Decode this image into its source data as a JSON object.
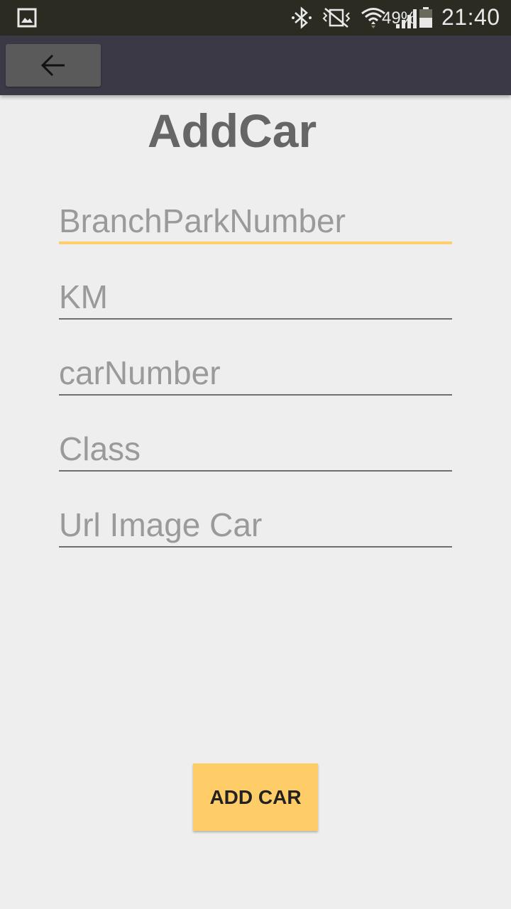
{
  "status_bar": {
    "battery_percent": "49%",
    "time": "21:40",
    "icons": [
      "gallery-icon",
      "bluetooth-icon",
      "vibrate-mute-icon",
      "wifi-icon",
      "signal-icon",
      "battery-icon"
    ]
  },
  "app_bar": {
    "back_icon": "arrow-left-icon"
  },
  "page": {
    "title": "AddCar"
  },
  "form": {
    "fields": [
      {
        "placeholder": "BranchParkNumber",
        "value": ""
      },
      {
        "placeholder": "KM",
        "value": ""
      },
      {
        "placeholder": "carNumber",
        "value": ""
      },
      {
        "placeholder": "Class",
        "value": ""
      },
      {
        "placeholder": "Url Image Car",
        "value": ""
      }
    ],
    "submit_label": "ADD CAR"
  },
  "colors": {
    "status_bar_bg": "#2c2b22",
    "app_bar_bg": "#3c3947",
    "page_bg": "#eeeeee",
    "accent": "#ffcd67",
    "title_text": "#666666"
  }
}
